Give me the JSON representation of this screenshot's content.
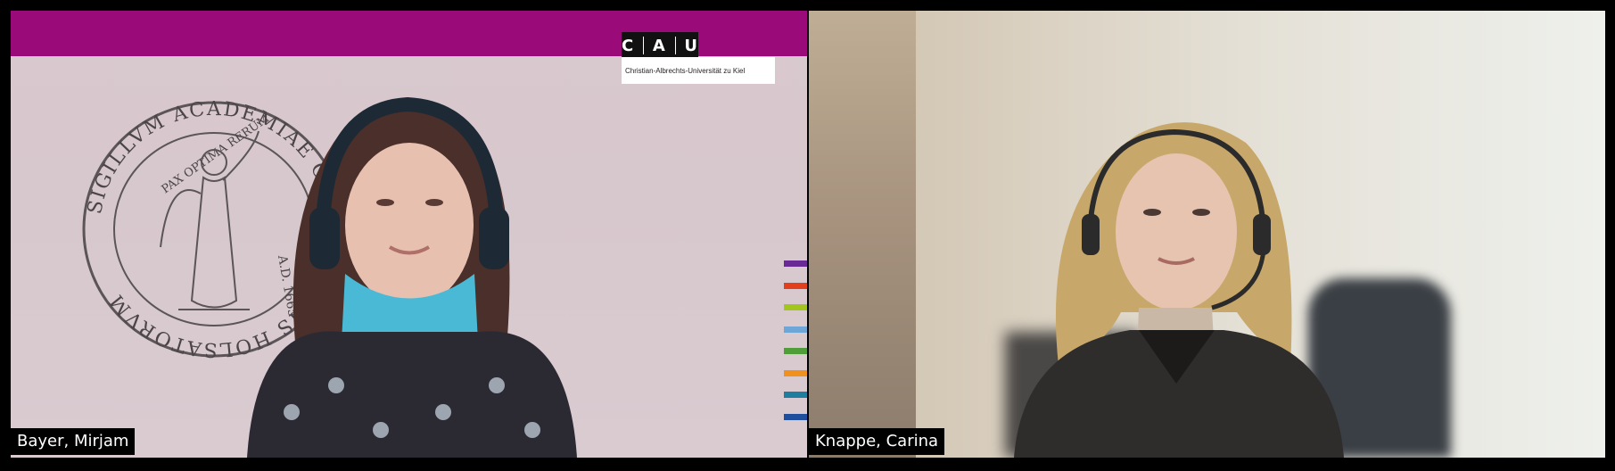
{
  "participants": [
    {
      "name": "Bayer, Mirjam",
      "background": {
        "logo_letters": [
          "C",
          "A",
          "U"
        ],
        "logo_subtitle": "Christian-Albrechts-Universität zu Kiel",
        "seal_text": "SIGILLVM ACADEMIAE CHILONIENSIS HOLSATORVM",
        "seal_motto": "PAX OPTIMA RERUM",
        "seal_year": "A.D. 1665",
        "banner_color": "#9a0a79",
        "stripe_colors": [
          "#6a2a96",
          "#e2401d",
          "#a3c61e",
          "#6fa6d8",
          "#4f9e3a",
          "#f0901d",
          "#1f7ea0",
          "#1f4f9c"
        ]
      }
    },
    {
      "name": "Knappe, Carina"
    }
  ]
}
